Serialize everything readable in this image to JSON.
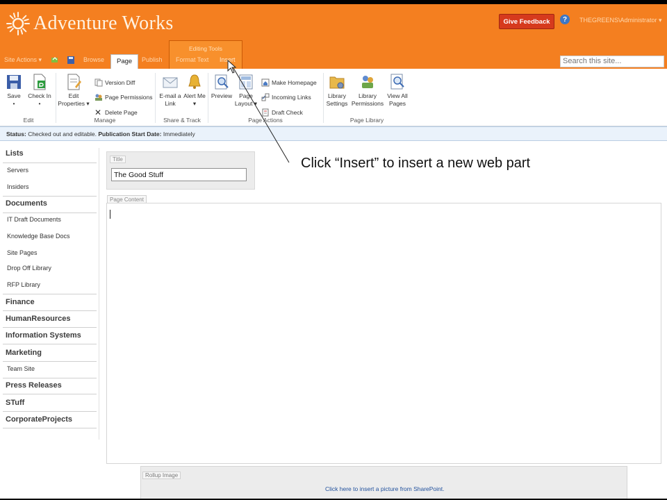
{
  "site": {
    "title": "Adventure Works"
  },
  "header": {
    "give_feedback": "Give Feedback",
    "help_icon_text": "?",
    "user": "THEGREENS\\Administrator",
    "site_actions": "Site Actions",
    "tabs": {
      "browse": "Browse",
      "page": "Page",
      "publish": "Publish",
      "format_text": "Format Text",
      "insert": "Insert"
    },
    "tab_group": "Editing Tools",
    "search_placeholder": "Search this site..."
  },
  "ribbon": {
    "edit": {
      "save": "Save",
      "check_in": "Check In",
      "group": "Edit"
    },
    "manage": {
      "edit_properties": "Edit Properties",
      "version_diff": "Version Diff",
      "page_permissions": "Page Permissions",
      "delete_page": "Delete Page",
      "group": "Manage"
    },
    "share_track": {
      "email_link": "E-mail a Link",
      "alert_me": "Alert Me",
      "group": "Share & Track"
    },
    "page_actions": {
      "preview": "Preview",
      "page_layout": "Page Layout",
      "make_homepage": "Make Homepage",
      "incoming_links": "Incoming Links",
      "draft_check": "Draft Check",
      "group": "Page Actions"
    },
    "page_library": {
      "library_settings": "Library Settings",
      "library_permissions": "Library Permissions",
      "view_all_pages": "View All Pages",
      "group": "Page Library"
    }
  },
  "status": {
    "label": "Status:",
    "text": "Checked out and editable.",
    "pub_label": "Publication Start Date:",
    "pub_value": "Immediately"
  },
  "nav": {
    "lists": "Lists",
    "servers": "Servers",
    "insiders": "Insiders",
    "documents": "Documents",
    "it_draft_documents": "IT Draft Documents",
    "knowledge_base_docs": "Knowledge Base Docs",
    "site_pages": "Site Pages",
    "drop_off_library": "Drop Off Library",
    "rfp_library": "RFP Library",
    "finance": "Finance",
    "human_resources": "HumanResources",
    "information_systems": "Information Systems",
    "marketing": "Marketing",
    "team_site": "Team Site",
    "press_releases": "Press Releases",
    "stuff": "STuff",
    "corporate_projects": "CorporateProjects"
  },
  "page": {
    "title_label": "Title",
    "title_value": "The Good Stuff",
    "content_label": "Page Content",
    "rollup_label": "Rollup Image",
    "rollup_link": "Click here to insert a picture from SharePoint."
  },
  "annotation": {
    "text": "Click “Insert” to insert a new web part"
  },
  "colors": {
    "header": "#f47f20",
    "feedback": "#d63a1d",
    "status_bg": "#eaf2fb"
  }
}
